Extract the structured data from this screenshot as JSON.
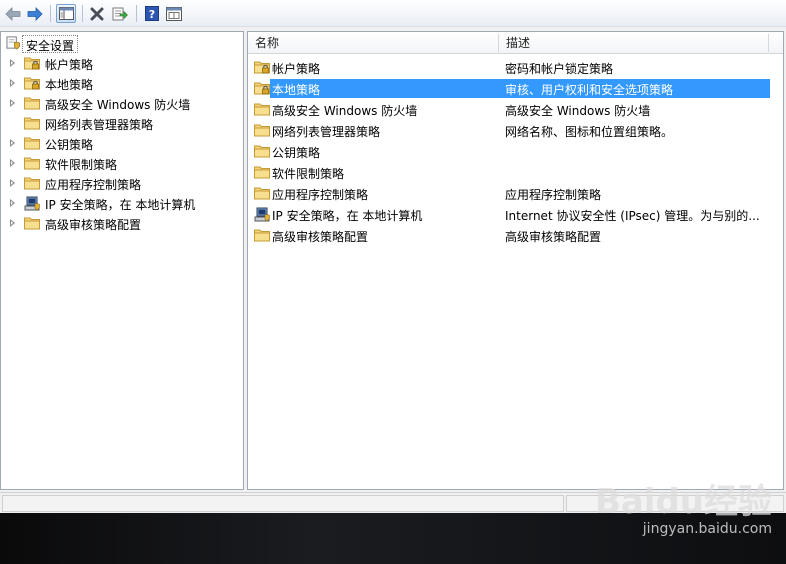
{
  "toolbar": {
    "buttons": [
      "back-icon",
      "forward-icon",
      "show-tree-icon",
      "delete-icon",
      "export-list-icon",
      "help-icon",
      "properties-icon"
    ]
  },
  "tree": {
    "root": "安全设置",
    "items": [
      {
        "label": "帐户策略",
        "icon": "lock-folder-icon"
      },
      {
        "label": "本地策略",
        "icon": "lock-folder-icon"
      },
      {
        "label": "高级安全 Windows 防火墙",
        "icon": "folder-icon"
      },
      {
        "label": "网络列表管理器策略",
        "icon": "folder-icon"
      },
      {
        "label": "公钥策略",
        "icon": "folder-icon"
      },
      {
        "label": "软件限制策略",
        "icon": "folder-icon"
      },
      {
        "label": "应用程序控制策略",
        "icon": "folder-icon"
      },
      {
        "label": "IP 安全策略，在 本地计算机",
        "icon": "ipsec-computer-icon"
      },
      {
        "label": "高级审核策略配置",
        "icon": "folder-icon"
      }
    ]
  },
  "list": {
    "columns": {
      "name": "名称",
      "desc": "描述"
    },
    "rows": [
      {
        "name": "帐户策略",
        "desc": "密码和帐户锁定策略"
      },
      {
        "name": "本地策略",
        "desc": "审核、用户权利和安全选项策略"
      },
      {
        "name": "高级安全 Windows 防火墙",
        "desc": "高级安全 Windows 防火墙"
      },
      {
        "name": "网络列表管理器策略",
        "desc": "网络名称、图标和位置组策略。"
      },
      {
        "name": "公钥策略",
        "desc": ""
      },
      {
        "name": "软件限制策略",
        "desc": ""
      },
      {
        "name": "应用程序控制策略",
        "desc": "应用程序控制策略"
      },
      {
        "name": "IP 安全策略，在 本地计算机",
        "desc": "Internet 协议安全性 (IPsec) 管理。为与别的..."
      },
      {
        "name": "高级审核策略配置",
        "desc": "高级审核策略配置"
      }
    ],
    "selected_index": 1
  },
  "watermark": {
    "brand": "Baidu经验",
    "url": "jingyan.baidu.com"
  },
  "colors": {
    "selection": "#3399ff",
    "folder": "#f2d27a",
    "arrow": "#3b7fd6"
  }
}
